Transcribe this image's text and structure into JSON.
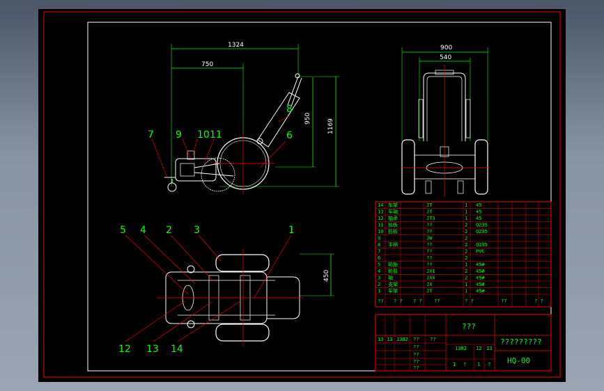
{
  "dimensions": {
    "overall_length": "1324",
    "wheel_offset": "750",
    "overall_height": "1169",
    "handle_height": "950",
    "overall_width": "900",
    "track_width": "540",
    "plan_width": "450"
  },
  "side_view_callouts": [
    "7",
    "9",
    "10",
    "11",
    "8",
    "6"
  ],
  "plan_view_callouts": [
    "5",
    "4",
    "2",
    "3",
    "1",
    "12",
    "13",
    "14"
  ],
  "bom_rows": [
    {
      "no": "14",
      "name": "车架",
      "code": "JT",
      "qty": "1",
      "mat": "45"
    },
    {
      "no": "13",
      "name": "车轴",
      "code": "JT",
      "qty": "1",
      "mat": "45"
    },
    {
      "no": "12",
      "name": "轴承",
      "code": "JT3",
      "qty": "1",
      "mat": "45"
    },
    {
      "no": "11",
      "name": "拉板",
      "code": "??",
      "qty": "2",
      "mat": "Q235"
    },
    {
      "no": "10",
      "name": "拉板",
      "code": "??",
      "qty": "2",
      "mat": "Q235"
    },
    {
      "no": "9",
      "name": "",
      "code": "JW",
      "qty": "2",
      "mat": ""
    },
    {
      "no": "8",
      "name": "手柄",
      "code": "??",
      "qty": "2",
      "mat": "Q235"
    },
    {
      "no": "7",
      "name": "",
      "code": "??",
      "qty": "2",
      "mat": "PVC"
    },
    {
      "no": "6",
      "name": "",
      "code": "??",
      "qty": "2",
      "mat": ""
    },
    {
      "no": "5",
      "name": "轮胎",
      "code": "??",
      "qty": "1",
      "mat": "45#"
    },
    {
      "no": "4",
      "name": "轮毂",
      "code": "JX1",
      "qty": "2",
      "mat": "45#"
    },
    {
      "no": "3",
      "name": "轴",
      "code": "JXX",
      "qty": "2",
      "mat": "45#"
    },
    {
      "no": "2",
      "name": "支架",
      "code": "JX",
      "qty": "1",
      "mat": "45#"
    },
    {
      "no": "1",
      "name": "车架",
      "code": "JT",
      "qty": "1",
      "mat": "45#"
    }
  ],
  "bom_header": [
    "??",
    "? ?",
    "? ?",
    "??",
    "? ?",
    "??",
    "? ?"
  ],
  "title_block": {
    "title": "???",
    "company": "?????????",
    "drawing_no": "HQ-00",
    "cells": [
      "13",
      "13",
      "1302",
      "??",
      "??",
      "??",
      "??",
      "1302",
      "12",
      "13",
      "??",
      "??",
      "1",
      "?",
      "1",
      "?"
    ]
  },
  "colors": {
    "background": "#000000",
    "border": "#ff0000",
    "inner_frame": "#ffffff",
    "dimension": "#00ff00",
    "center_line": "#ff0000",
    "callout": "#00ff00",
    "outline": "#ffffff"
  }
}
